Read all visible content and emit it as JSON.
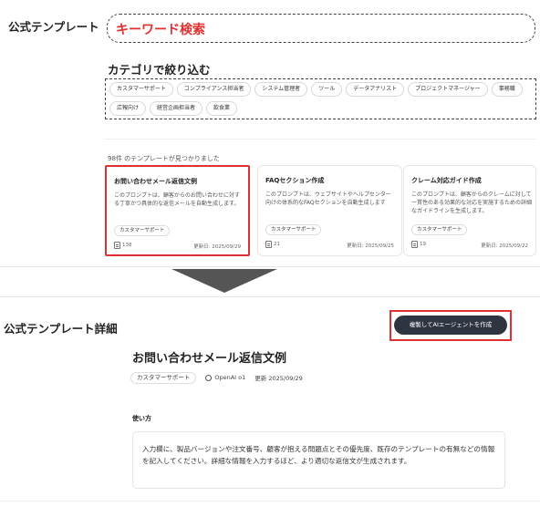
{
  "top": {
    "sidebar_title": "公式テンプレート",
    "search_label": "キーワード検索",
    "category_title": "カテゴリで絞り込む",
    "categories": [
      "カスタマーサポート",
      "コンプライアンス担当者",
      "システム管理者",
      "ツール",
      "データアナリスト",
      "プロジェクトマネージャー",
      "事務職",
      "広報向け",
      "経営企画担当者",
      "飲食業"
    ],
    "result_count": "98件 のテンプレートが見つかりました",
    "cards": [
      {
        "title": "お問い合わせメール返信文例",
        "desc": "このプロンプトは、顧客からのお問い合わせに対する丁寧かつ具体的な返信メールを自動生成します。",
        "tag": "カスタマーサポート",
        "count": "138",
        "date": "更新日: 2025/09/29"
      },
      {
        "title": "FAQセクション作成",
        "desc": "このプロンプトは、ウェブサイトやヘルプセンター向けの体系的なFAQセクションを自動生成します",
        "tag": "カスタマーサポート",
        "count": "21",
        "date": "更新日: 2025/09/25"
      },
      {
        "title": "クレーム対応ガイド作成",
        "desc": "このプロンプトは、顧客からのクレームに対して一貫性のある効果的な対応を実施するための詳細なガイドラインを生成します。",
        "tag": "カスタマーサポート",
        "count": "19",
        "date": "更新日: 2025/09/22"
      }
    ]
  },
  "detail": {
    "header": "公式テンプレート詳細",
    "copy_button": "複製してAIエージェントを作成",
    "title": "お問い合わせメール返信文例",
    "tag": "カスタマーサポート",
    "model": "OpenAI o1",
    "updated": "更新 2025/09/29",
    "usage_label": "使い方",
    "usage_text": "入力欄に、製品バージョンや注文番号、顧客が抱える問題点とその優先度、既存のテンプレートの有無などの情報を記入してください。詳細な情報を入力するほど、より適切な返信文が生成されます。"
  },
  "colors": {
    "highlight": "#e03030",
    "button_bg": "#2e3440",
    "arrow": "#555555"
  },
  "icons": [
    "document-icon",
    "gear-icon",
    "arrow-down-icon"
  ]
}
